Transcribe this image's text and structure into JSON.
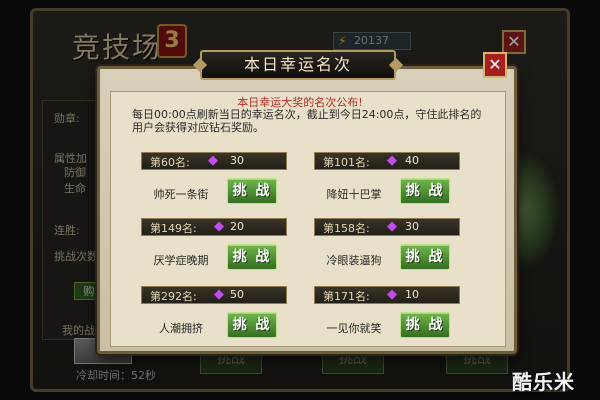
{
  "background": {
    "title": "竞技场",
    "logo_glyph": "3",
    "currency_value": "20137",
    "side_labels": [
      "勋章:",
      "属性加",
      "防御",
      "生命",
      "连胜:",
      "挑战次数"
    ],
    "green_button": "购",
    "grey_button": "挑",
    "my_rank_label": "我的战力",
    "cooldown_text": "冷却时间：52秒",
    "bottom_buttons": [
      "挑战",
      "挑战",
      "挑战"
    ],
    "close_glyph": "✕"
  },
  "popup": {
    "title": "本日幸运名次",
    "close_glyph": "✕",
    "announcement": "本日幸运大奖的名次公布!",
    "description": "每日00:00点刷新当日的幸运名次，截止到今日24:00点，守住此排名的用户会获得对应钻石奖励。",
    "fight_label": "挑 战",
    "entries": [
      {
        "rank": "第60名:",
        "reward": "30",
        "player": "帅死一条街"
      },
      {
        "rank": "第101名:",
        "reward": "40",
        "player": "降妞十巴掌"
      },
      {
        "rank": "第149名:",
        "reward": "20",
        "player": "厌学症晚期"
      },
      {
        "rank": "第158名:",
        "reward": "30",
        "player": "冷眼装逼狗"
      },
      {
        "rank": "第292名:",
        "reward": "50",
        "player": "人潮拥挤"
      },
      {
        "rank": "第171名:",
        "reward": "10",
        "player": "一见你就笑"
      }
    ]
  },
  "watermark": "酷乐米",
  "icons": {
    "gem": "purple-diamond-icon",
    "currency": "lightning-bolt-icon",
    "close": "close-icon"
  },
  "colors": {
    "gem": "#c24cf0",
    "fight_button": "#4f8f35",
    "announcement": "#b0302a",
    "close_button": "#a61e1e"
  }
}
